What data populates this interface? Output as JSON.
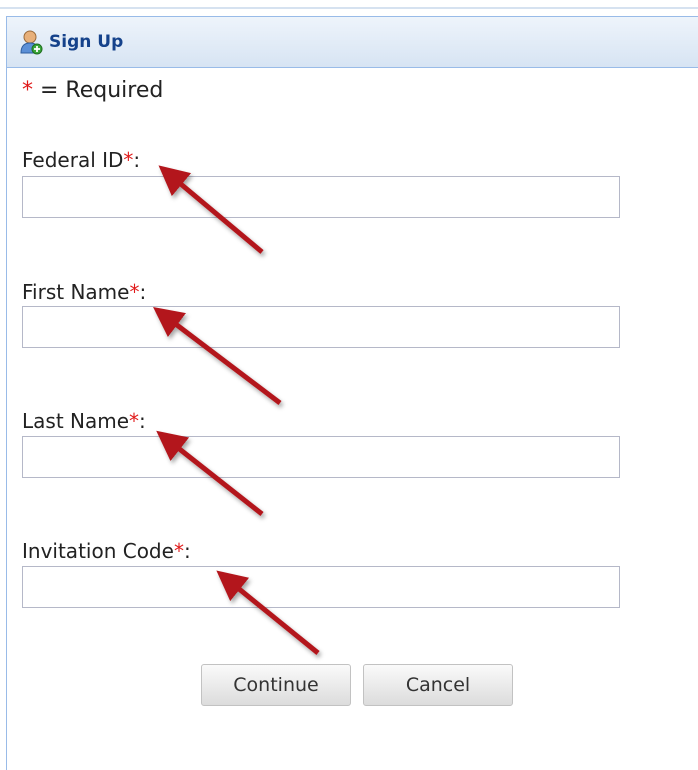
{
  "dialog": {
    "title": "Sign Up",
    "icon": "user-add-icon"
  },
  "required_note": {
    "star": "*",
    "text": " = Required"
  },
  "fields": [
    {
      "label": "Federal ID",
      "star": "*",
      "colon": ":",
      "value": ""
    },
    {
      "label": "First Name",
      "star": "*",
      "colon": ":",
      "value": ""
    },
    {
      "label": "Last Name",
      "star": "*",
      "colon": ":",
      "value": ""
    },
    {
      "label": "Invitation Code",
      "star": "*",
      "colon": ":",
      "value": ""
    }
  ],
  "buttons": {
    "continue_label": "Continue",
    "cancel_label": "Cancel"
  },
  "colors": {
    "required_star": "#e01a1a",
    "header_text": "#15428b",
    "annotation_arrow": "#b3161b"
  }
}
